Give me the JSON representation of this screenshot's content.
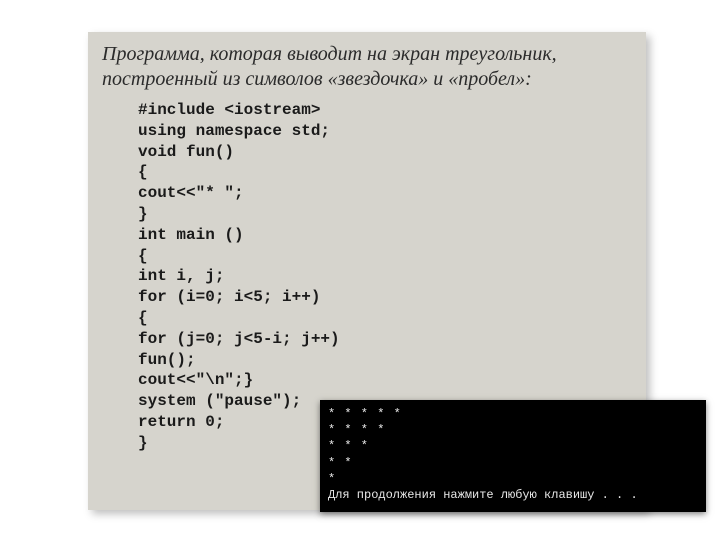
{
  "heading": {
    "line1": "Программа, которая выводит на экран треугольник,",
    "line2": "построенный из символов «звездочка» и «пробел»:"
  },
  "code": {
    "l1": "#include <iostream>",
    "l2": "using namespace std;",
    "l3": "void fun()",
    "l4": "{",
    "l5": "cout<<\"* \";",
    "l6": "}",
    "l7": "int main ()",
    "l8": "{",
    "l9": "int i, j;",
    "l10": "for (i=0; i<5; i++)",
    "l11": "{",
    "l12": "for (j=0; j<5-i; j++)",
    "l13": "fun();",
    "l14": "cout<<\"\\n\";}",
    "l15": "system (\"pause\");",
    "l16": "return 0;",
    "l17": "}"
  },
  "console": {
    "row1": "* * * * *",
    "row2": "* * * *",
    "row3": "* * *",
    "row4": "* *",
    "row5": "*",
    "pause": "Для продолжения нажмите любую клавишу . . ."
  }
}
